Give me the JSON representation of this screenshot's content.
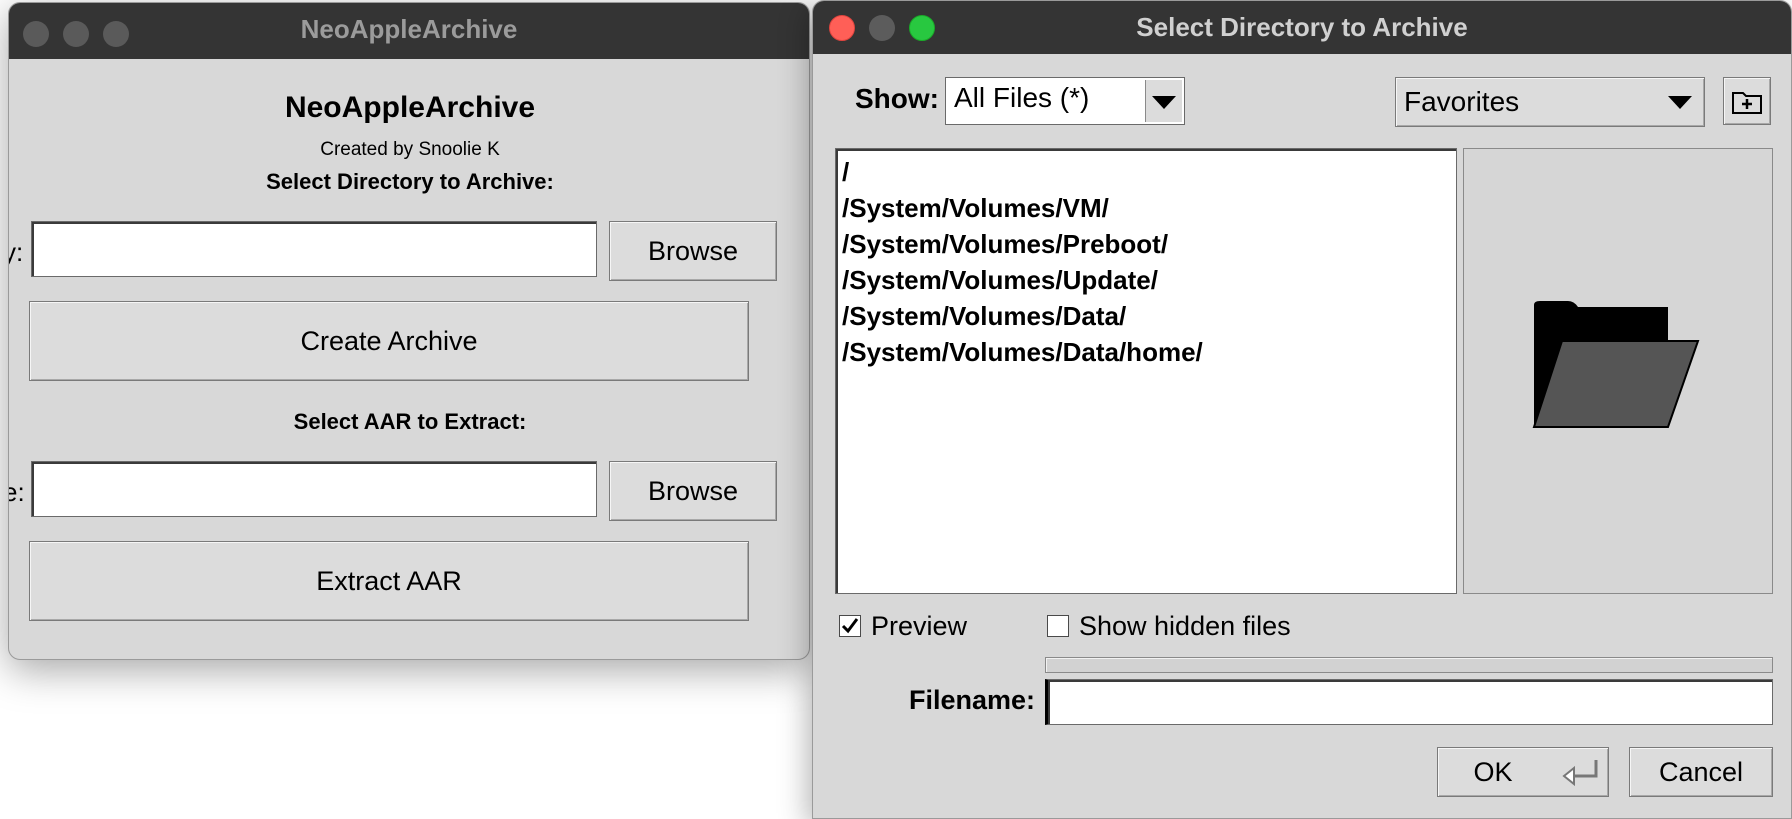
{
  "main_window": {
    "title": "NeoAppleArchive",
    "app_heading": "NeoAppleArchive",
    "credit": "Created by Snoolie K",
    "archive_section_label": "Select Directory to Archive:",
    "directory_field_label_fragment": "y:",
    "directory_value": "",
    "browse_label_1": "Browse",
    "create_archive_label": "Create Archive",
    "extract_section_label": "Select AAR to Extract:",
    "file_field_label_fragment": "e:",
    "file_value": "",
    "browse_label_2": "Browse",
    "extract_label": "Extract AAR"
  },
  "dialog": {
    "title": "Select Directory to Archive",
    "show_label": "Show:",
    "filter_value": "All Files (*)",
    "favorites_value": "Favorites",
    "new_folder_icon": "new-folder-icon",
    "paths": [
      "/",
      "/System/Volumes/VM/",
      "/System/Volumes/Preboot/",
      "/System/Volumes/Update/",
      "/System/Volumes/Data/",
      "/System/Volumes/Data/home/"
    ],
    "preview_icon": "folder-open-icon",
    "preview_label": "Preview",
    "preview_checked": true,
    "hidden_label": "Show hidden files",
    "hidden_checked": false,
    "filename_label": "Filename:",
    "filename_value": "",
    "ok_label": "OK",
    "cancel_label": "Cancel"
  },
  "colors": {
    "window_bg": "#d8d8d8",
    "titlebar_bg": "#343434",
    "close_red": "#ff5f57",
    "zoom_green": "#28c840"
  }
}
